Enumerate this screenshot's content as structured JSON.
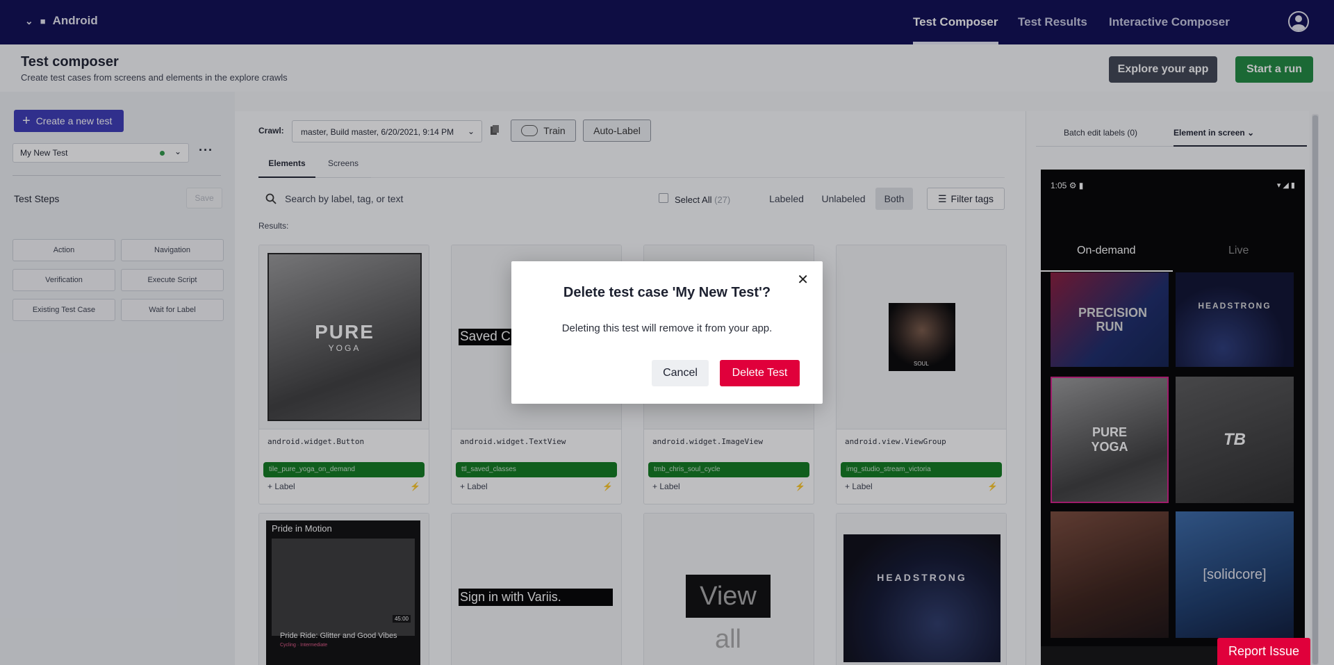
{
  "topnav": {
    "platform": "Android",
    "tabs": [
      {
        "label": "Test Composer",
        "active": true
      },
      {
        "label": "Test Results",
        "active": false
      },
      {
        "label": "Interactive Composer",
        "active": false
      }
    ],
    "colors": {
      "bg": "#0c0a52"
    }
  },
  "header": {
    "title": "Test composer",
    "subtitle": "Create test cases from screens and elements in the explore crawls",
    "explore_label": "Explore your app",
    "start_label": "Start a run"
  },
  "left": {
    "create_label": "Create a new test",
    "test_name": "My New Test",
    "steps_title": "Test Steps",
    "save_label": "Save",
    "step_buttons": [
      "Action",
      "Navigation",
      "Verification",
      "Execute Script",
      "Existing Test Case",
      "Wait for Label"
    ]
  },
  "center": {
    "crawl_label": "Crawl:",
    "crawl_value": "master, Build master, 6/20/2021, 9:14 PM",
    "train_label": "Train",
    "autolabel_label": "Auto-Label",
    "tabs": [
      "Elements",
      "Screens"
    ],
    "search_placeholder": "Search by label, tag, or text",
    "select_all": "Select All",
    "select_all_count": "(27)",
    "filters": [
      "Labeled",
      "Unlabeled",
      "Both"
    ],
    "filter_tags": "Filter tags",
    "results_label": "Results:",
    "add_label": "+ Label",
    "cards": [
      {
        "type": "android.widget.Button",
        "tag": "tile_pure_yoga_on_demand",
        "thumb_text": "PURE",
        "thumb_sub": "YOGA"
      },
      {
        "type": "android.widget.TextView",
        "tag": "ttl_saved_classes",
        "thumb_text": "Saved Cla"
      },
      {
        "type": "android.widget.ImageView",
        "tag": "tmb_chris_soul_cycle",
        "thumb_text": ""
      },
      {
        "type": "android.view.ViewGroup",
        "tag": "img_studio_stream_victoria",
        "thumb_text": "SOUL"
      },
      {
        "thumb_text": "Pride in Motion",
        "thumb_sub": "Pride Ride: Glitter and Good Vibes",
        "thumb_meta": "Cycling · Intermediate",
        "thumb_time": "45:00"
      },
      {
        "thumb_text": "Sign in with Variis."
      },
      {
        "thumb_text": "View all"
      },
      {
        "thumb_text": "HEADSTRONG"
      }
    ]
  },
  "right": {
    "batch_label": "Batch edit labels (0)",
    "element_label": "Element in screen",
    "phone": {
      "time": "1:05",
      "tabs": [
        "On-demand",
        "Live"
      ],
      "tiles": [
        "PRECISION RUN",
        "HEADSTRONG",
        "PURE YOGA",
        "TB",
        "",
        "[solidcore]"
      ]
    }
  },
  "modal": {
    "title": "Delete test case 'My New Test'?",
    "message": "Deleting this test will remove it from your app.",
    "cancel_label": "Cancel",
    "delete_label": "Delete Test"
  },
  "report_label": "Report Issue",
  "colors": {
    "primary": "#3b39b8",
    "success": "#1e8a3f",
    "danger": "#e0003b",
    "tag": "#0f7a1e"
  }
}
